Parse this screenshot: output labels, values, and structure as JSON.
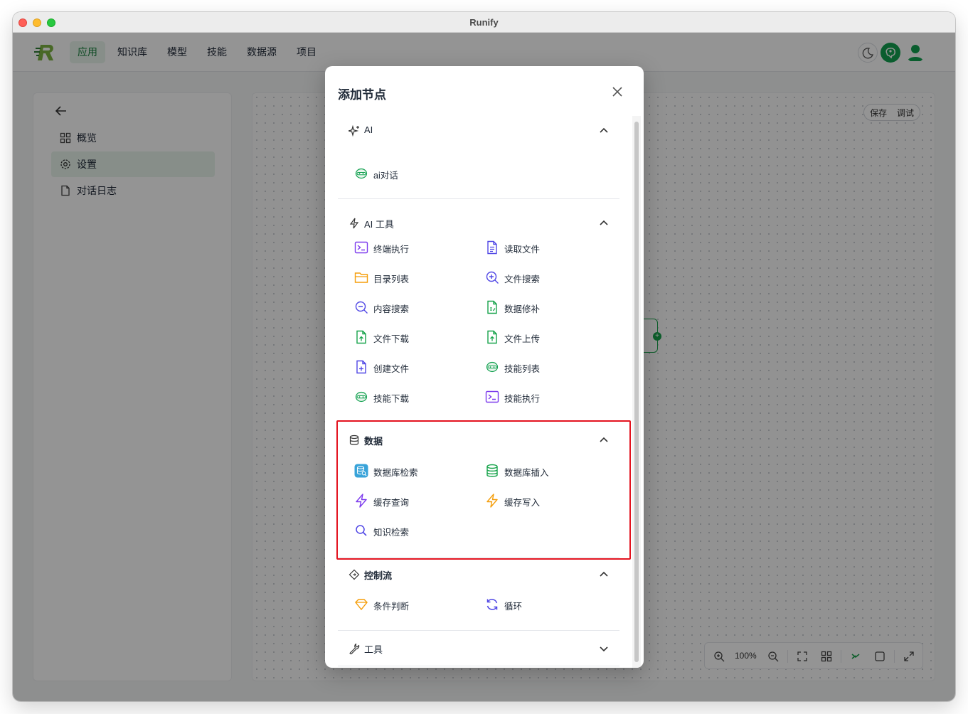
{
  "window": {
    "title": "Runify"
  },
  "nav": {
    "items": [
      "应用",
      "知识库",
      "模型",
      "技能",
      "数据源",
      "项目"
    ],
    "active": 0
  },
  "sidebar": {
    "items": [
      "概览",
      "设置",
      "对话日志"
    ]
  },
  "canvas": {
    "save": "保存",
    "debug": "调试",
    "zoom": "100%"
  },
  "modal": {
    "title": "添加节点",
    "sections": [
      {
        "label": "AI",
        "expanded": true,
        "items": [
          "ai对话"
        ]
      },
      {
        "label": "AI 工具",
        "expanded": true,
        "items": [
          "终端执行",
          "读取文件",
          "目录列表",
          "文件搜索",
          "内容搜索",
          "数据修补",
          "文件下载",
          "文件上传",
          "创建文件",
          "技能列表",
          "技能下载",
          "技能执行"
        ]
      },
      {
        "label": "数据",
        "expanded": true,
        "items": [
          "数据库检索",
          "数据库插入",
          "缓存查询",
          "缓存写入",
          "知识检索"
        ]
      },
      {
        "label": "控制流",
        "expanded": true,
        "items": [
          "条件判断",
          "循环"
        ]
      },
      {
        "label": "工具",
        "expanded": false,
        "items": []
      }
    ]
  },
  "colors": {
    "accent": "#17a34a",
    "highlight": "#e3131f",
    "purple": "#7c3aed",
    "blue": "#4f46e5",
    "orange": "#f59e0b",
    "green": "#16a34a"
  }
}
